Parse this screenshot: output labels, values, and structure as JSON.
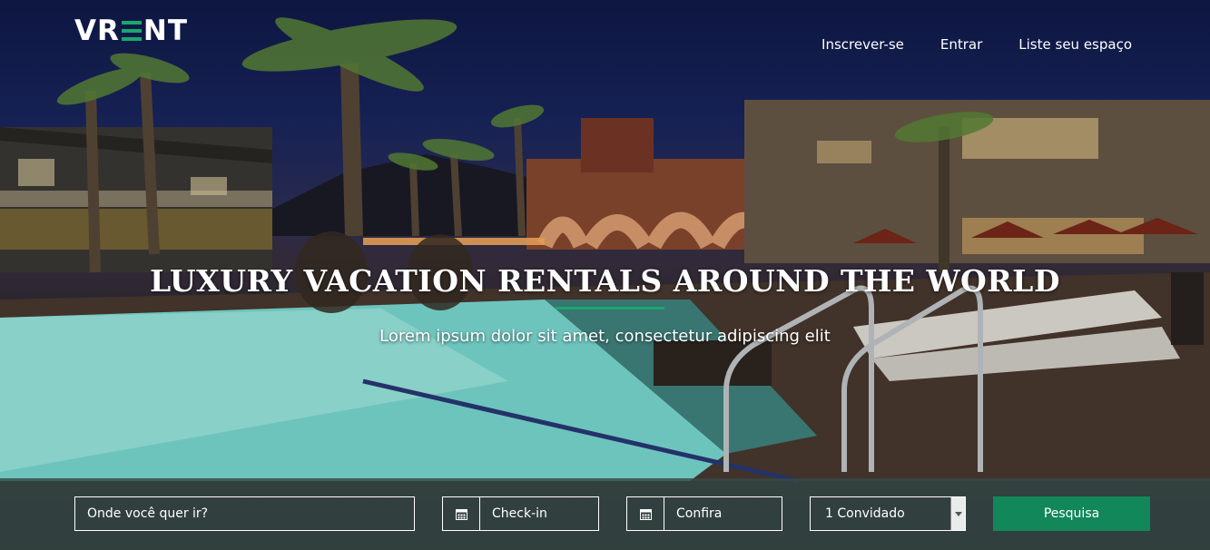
{
  "brand": {
    "logo_text_left": "VR",
    "logo_text_right": "NT",
    "accent": "#19a86e"
  },
  "nav": {
    "signup": "Inscrever-se",
    "login": "Entrar",
    "list_space": "Liste seu espaço"
  },
  "hero": {
    "title": "LUXURY VACATION RENTALS AROUND THE WORLD",
    "subtitle": "Lorem ipsum dolor sit amet, consectetur adipiscing elit"
  },
  "search": {
    "where_placeholder": "Onde você quer ir?",
    "checkin_placeholder": "Check-in",
    "checkout_placeholder": "Confira",
    "guests_value": "1 Convidado",
    "submit_label": "Pesquisa",
    "button_color": "#12875a"
  },
  "icons": {
    "calendar": "calendar-icon",
    "dropdown": "chevron-down-icon"
  }
}
